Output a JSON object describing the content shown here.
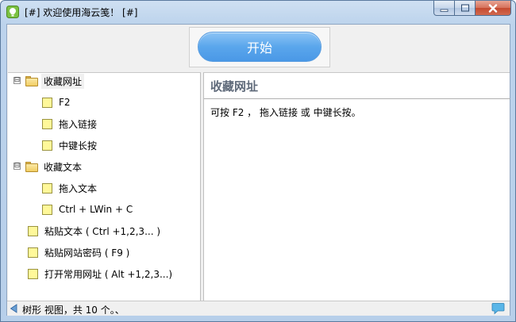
{
  "window": {
    "title": "[#] 欢迎使用海云笺！ [#]",
    "minimize_icon": "minimize-icon",
    "maximize_icon": "maximize-icon",
    "close_icon": "close-icon"
  },
  "toolbar": {
    "start_label": "开始"
  },
  "tree": {
    "groups": [
      {
        "label": "收藏网址",
        "expander": "⊟",
        "children": [
          "F2",
          "拖入链接",
          "中键长按"
        ]
      },
      {
        "label": "收藏文本",
        "expander": "⊟",
        "children": [
          "拖入文本",
          "Ctrl + LWin + C"
        ]
      }
    ],
    "items": [
      "粘贴文本 ( Ctrl +1,2,3... )",
      "粘贴网站密码 ( F9 )",
      "打开常用网址 ( Alt +1,2,3...)"
    ]
  },
  "detail": {
    "title": "收藏网址",
    "body": "可按 F2 ， 拖入链接 或 中键长按。"
  },
  "status": {
    "text": "树形 视图，共 10 个。、"
  },
  "colors": {
    "start_button": "#5aa6ec",
    "detail_title": "#5f6a7a",
    "leaf_fill": "#fff89a",
    "folder_fill": "#f2cd63",
    "close_button": "#c44a30"
  }
}
